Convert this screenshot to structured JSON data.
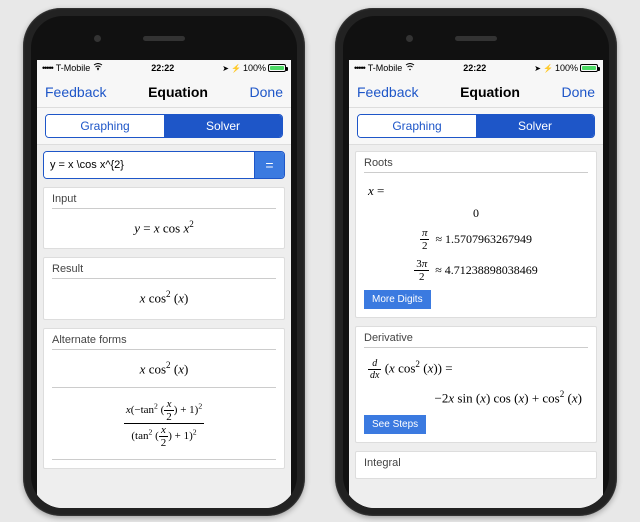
{
  "status": {
    "carrier": "T-Mobile",
    "time": "22:22",
    "battery": "100%"
  },
  "nav": {
    "left": "Feedback",
    "title": "Equation",
    "right": "Done"
  },
  "tabs": {
    "graphing": "Graphing",
    "solver": "Solver"
  },
  "left": {
    "input_value": "y = x \\cos x^{2}",
    "eq_symbol": "=",
    "sections": {
      "input": {
        "title": "Input",
        "expr": "y = x cos x²"
      },
      "result": {
        "title": "Result",
        "expr": "x cos² (x)"
      },
      "alternate": {
        "title": "Alternate forms",
        "expr1": "x cos² (x)",
        "expr2_num": "x(−tan² (x/2) + 1)²",
        "expr2_den": "(tan² (x/2) + 1)²"
      }
    }
  },
  "right": {
    "roots": {
      "title": "Roots",
      "x_label": "x =",
      "r0": "0",
      "r1_lhs": "π/2",
      "r1_rhs": "≈ 1.5707963267949",
      "r2_lhs": "3π/2",
      "r2_rhs": "≈ 4.71238898038469",
      "more": "More Digits"
    },
    "derivative": {
      "title": "Derivative",
      "lhs": "d/dx (x cos² (x)) =",
      "rhs": "−2x sin (x) cos (x) + cos² (x)",
      "see": "See Steps"
    },
    "integral": {
      "title": "Integral"
    }
  }
}
